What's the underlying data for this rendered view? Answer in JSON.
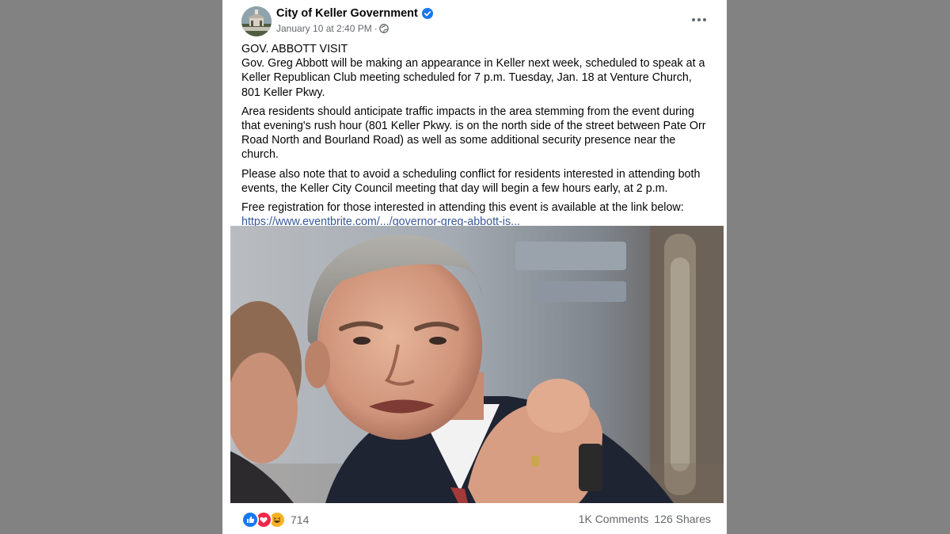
{
  "post": {
    "author": "City of Keller Government",
    "timestamp": "January 10 at 2:40 PM",
    "timestamp_separator": "·",
    "audience_icon": "globe-icon",
    "verified_icon": "verified-badge-icon",
    "more_icon": "more-options-icon",
    "heading": "GOV. ABBOTT VISIT",
    "paragraph_1": "Gov. Greg Abbott will be making an appearance in Keller next week, scheduled to speak at a Keller Republican Club meeting scheduled for 7 p.m. Tuesday, Jan. 18 at Venture Church, 801 Keller Pkwy.",
    "paragraph_2": "Area residents should anticipate traffic impacts in the area stemming from the event during that evening's rush hour (801 Keller Pkwy. is on the north side of the street between Pate Orr Road North and Bourland Road) as well as some additional security presence near the church.",
    "paragraph_3": "Please also note that to avoid a scheduling conflict for residents interested in attending both events, the Keller City Council meeting that day will begin a few hours early, at 2 p.m.",
    "paragraph_4": "Free registration for those interested in attending this event is available at the link below:",
    "link": "https://www.eventbrite.com/.../governor-greg-abbott-is..."
  },
  "engagement": {
    "reaction_icons": [
      "like-icon",
      "love-icon",
      "haha-icon"
    ],
    "reaction_count": "714",
    "comments": "1K Comments",
    "shares": "126 Shares"
  },
  "colors": {
    "page_background": "#828282",
    "card_background": "#ffffff",
    "text": "#050505",
    "secondary_text": "#65676b",
    "link": "#385898",
    "verified_blue": "#1877f2",
    "like_blue": "#1877f2",
    "love_red": "#f02849",
    "haha_yellow": "#f7b125"
  }
}
